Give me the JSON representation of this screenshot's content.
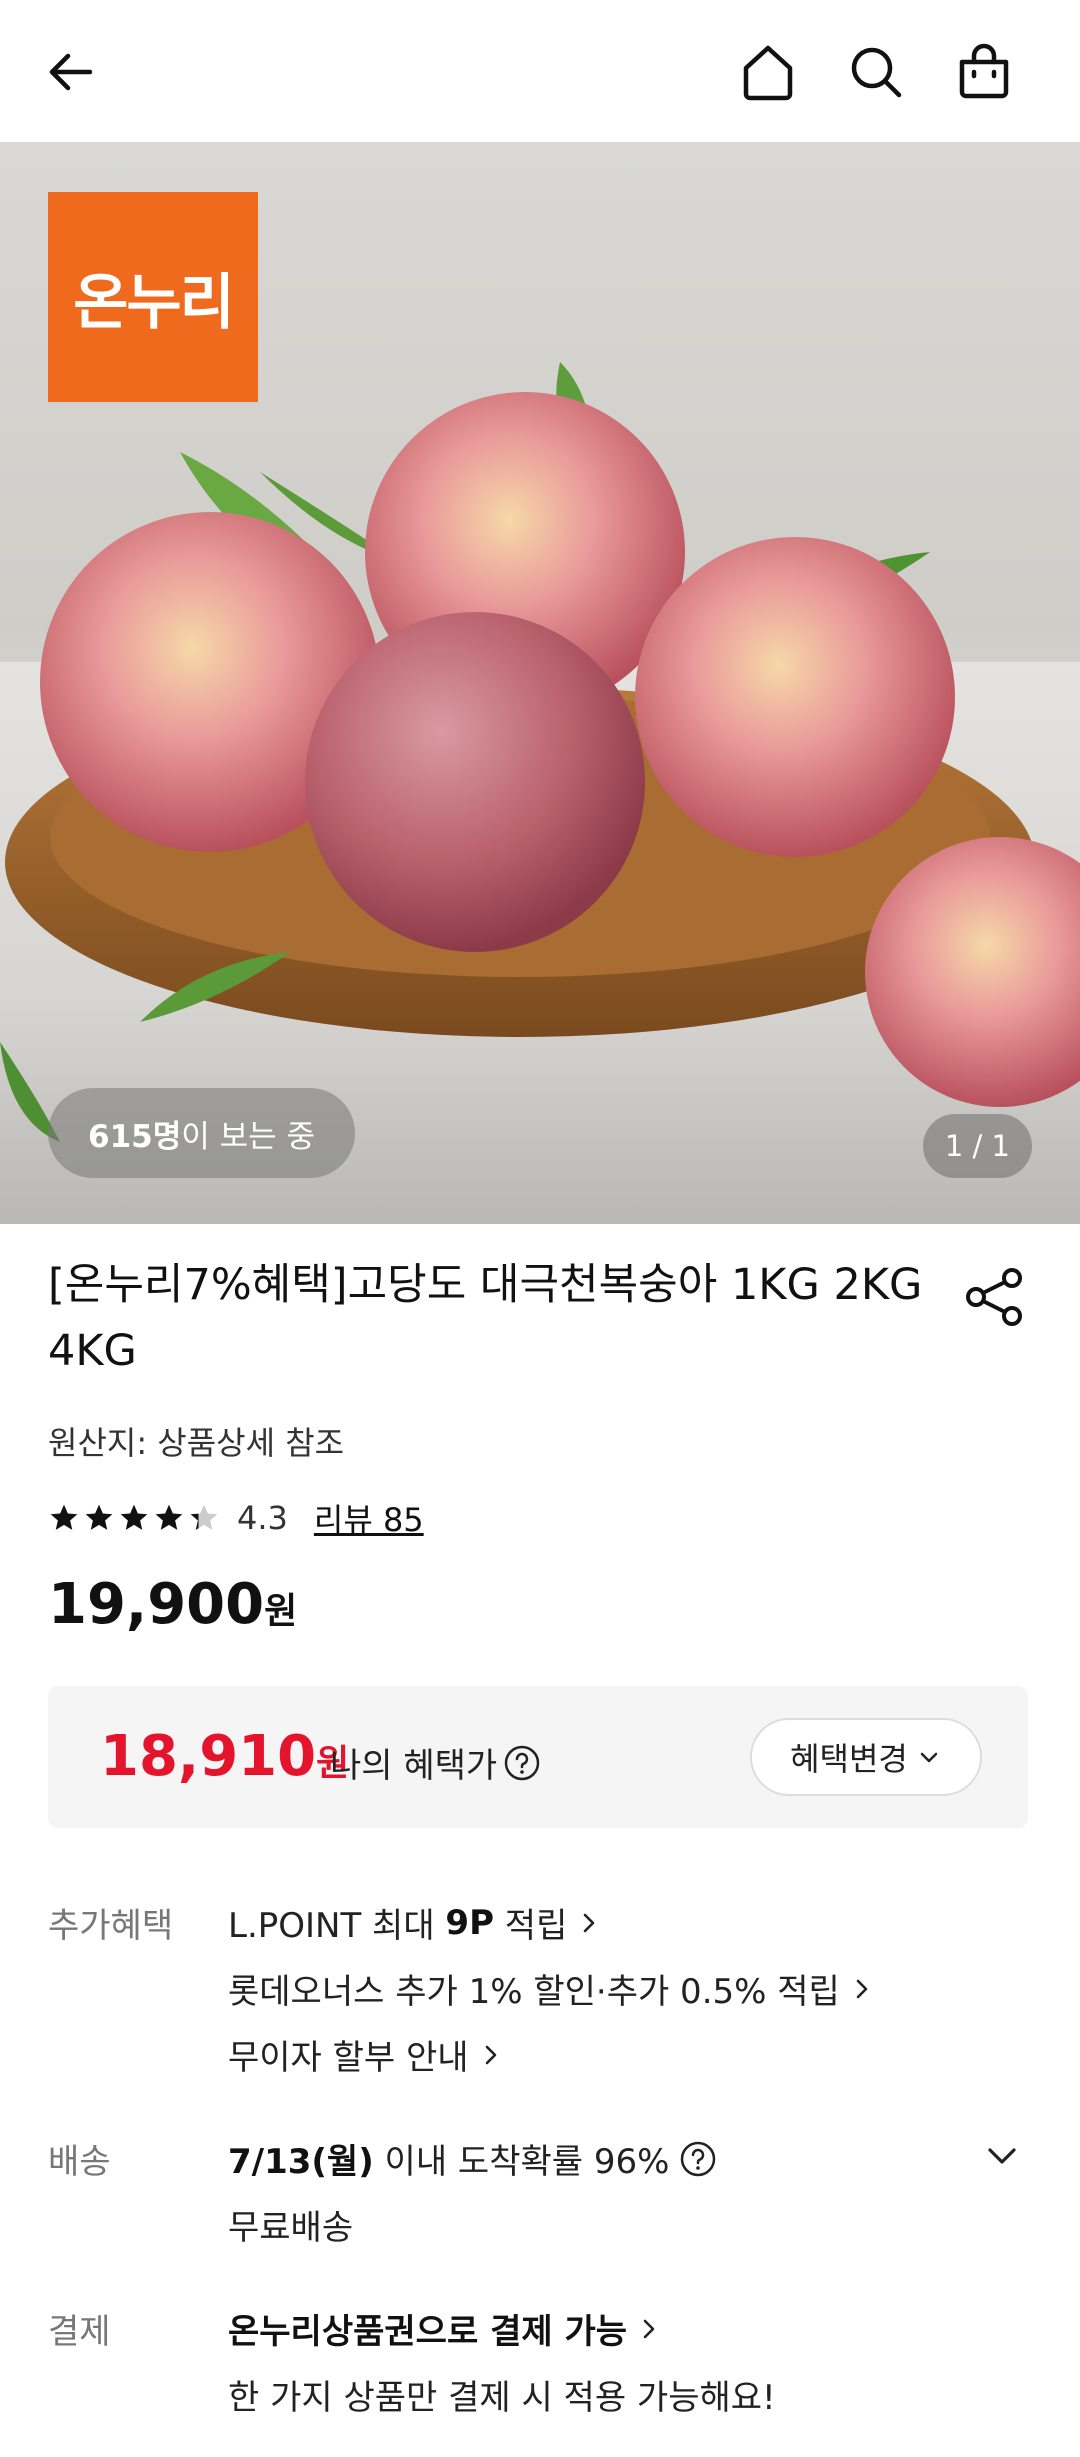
{
  "header": {
    "back_icon": "back-arrow-icon",
    "home_icon": "home-icon",
    "search_icon": "search-icon",
    "cart_icon": "shopping-bag-icon"
  },
  "hero": {
    "logo_text": "온누리",
    "viewers_count": "615명",
    "viewers_suffix": "이 보는 중",
    "pager": "1 / 1"
  },
  "product": {
    "title": "[온누리7%혜택]고당도 대극천복숭아 1KG 2KG 4KG",
    "origin": "원산지: 상품상세 참조",
    "rating_value": "4.3",
    "rating_stars": 4.3,
    "review_link": "리뷰 85",
    "price": "19,900",
    "price_unit": "원"
  },
  "benefit": {
    "price": "18,910",
    "price_unit": "원",
    "label": "나의 혜택가",
    "change_button": "혜택변경"
  },
  "extra": {
    "label": "추가혜택",
    "line1_prefix": "L.POINT 최대 ",
    "line1_bold": "9P",
    "line1_suffix": " 적립",
    "line2": "롯데오너스 추가 1% 할인·추가 0.5% 적립",
    "line3": "무이자 할부 안내"
  },
  "delivery": {
    "label": "배송",
    "date": "7/13(월)",
    "text": " 이내 도착확률 96%",
    "fee": "무료배송"
  },
  "payment": {
    "label": "결제",
    "line1": "온누리상품권으로 결제 가능",
    "line2": "한 가지 상품만 결제 시 적용 가능해요!"
  },
  "colors": {
    "accent_red": "#e3142c",
    "logo_orange": "#f06a1d"
  }
}
